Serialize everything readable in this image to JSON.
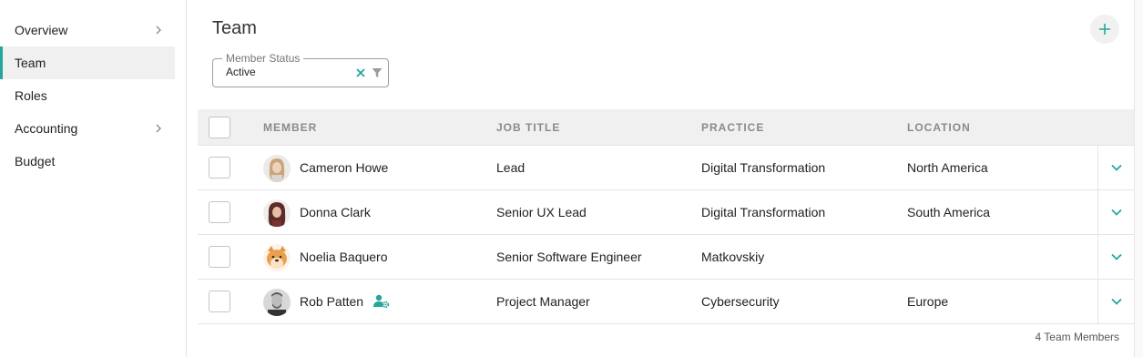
{
  "sidebar": {
    "items": [
      {
        "label": "Overview",
        "has_chevron": true,
        "active": false
      },
      {
        "label": "Team",
        "has_chevron": false,
        "active": true
      },
      {
        "label": "Roles",
        "has_chevron": false,
        "active": false
      },
      {
        "label": "Accounting",
        "has_chevron": true,
        "active": false
      },
      {
        "label": "Budget",
        "has_chevron": false,
        "active": false
      }
    ]
  },
  "page": {
    "title": "Team",
    "add_icon": "plus-icon"
  },
  "filter": {
    "label": "Member Status",
    "value": "Active",
    "clear_icon": "close-icon",
    "filter_icon": "funnel-icon"
  },
  "table": {
    "headers": {
      "member": "MEMBER",
      "job_title": "JOB TITLE",
      "practice": "PRACTICE",
      "location": "LOCATION"
    },
    "rows": [
      {
        "name": "Cameron Howe",
        "job_title": "Lead",
        "practice": "Digital Transformation",
        "location": "North America"
      },
      {
        "name": "Donna Clark",
        "job_title": "Senior UX Lead",
        "practice": "Digital Transformation",
        "location": "South America"
      },
      {
        "name": "Noelia Baquero",
        "job_title": "Senior Software Engineer",
        "practice": "Matkovskiy",
        "location": ""
      },
      {
        "name": "Rob Patten",
        "job_title": "Project Manager",
        "practice": "Cybersecurity",
        "location": "Europe",
        "badge_icon": "user-settings-icon"
      }
    ]
  },
  "footer": {
    "count": "4 Team Members"
  },
  "colors": {
    "accent": "#26a69a",
    "header_bg": "#f0f0f1",
    "active_bg": "#f0f0f0"
  }
}
